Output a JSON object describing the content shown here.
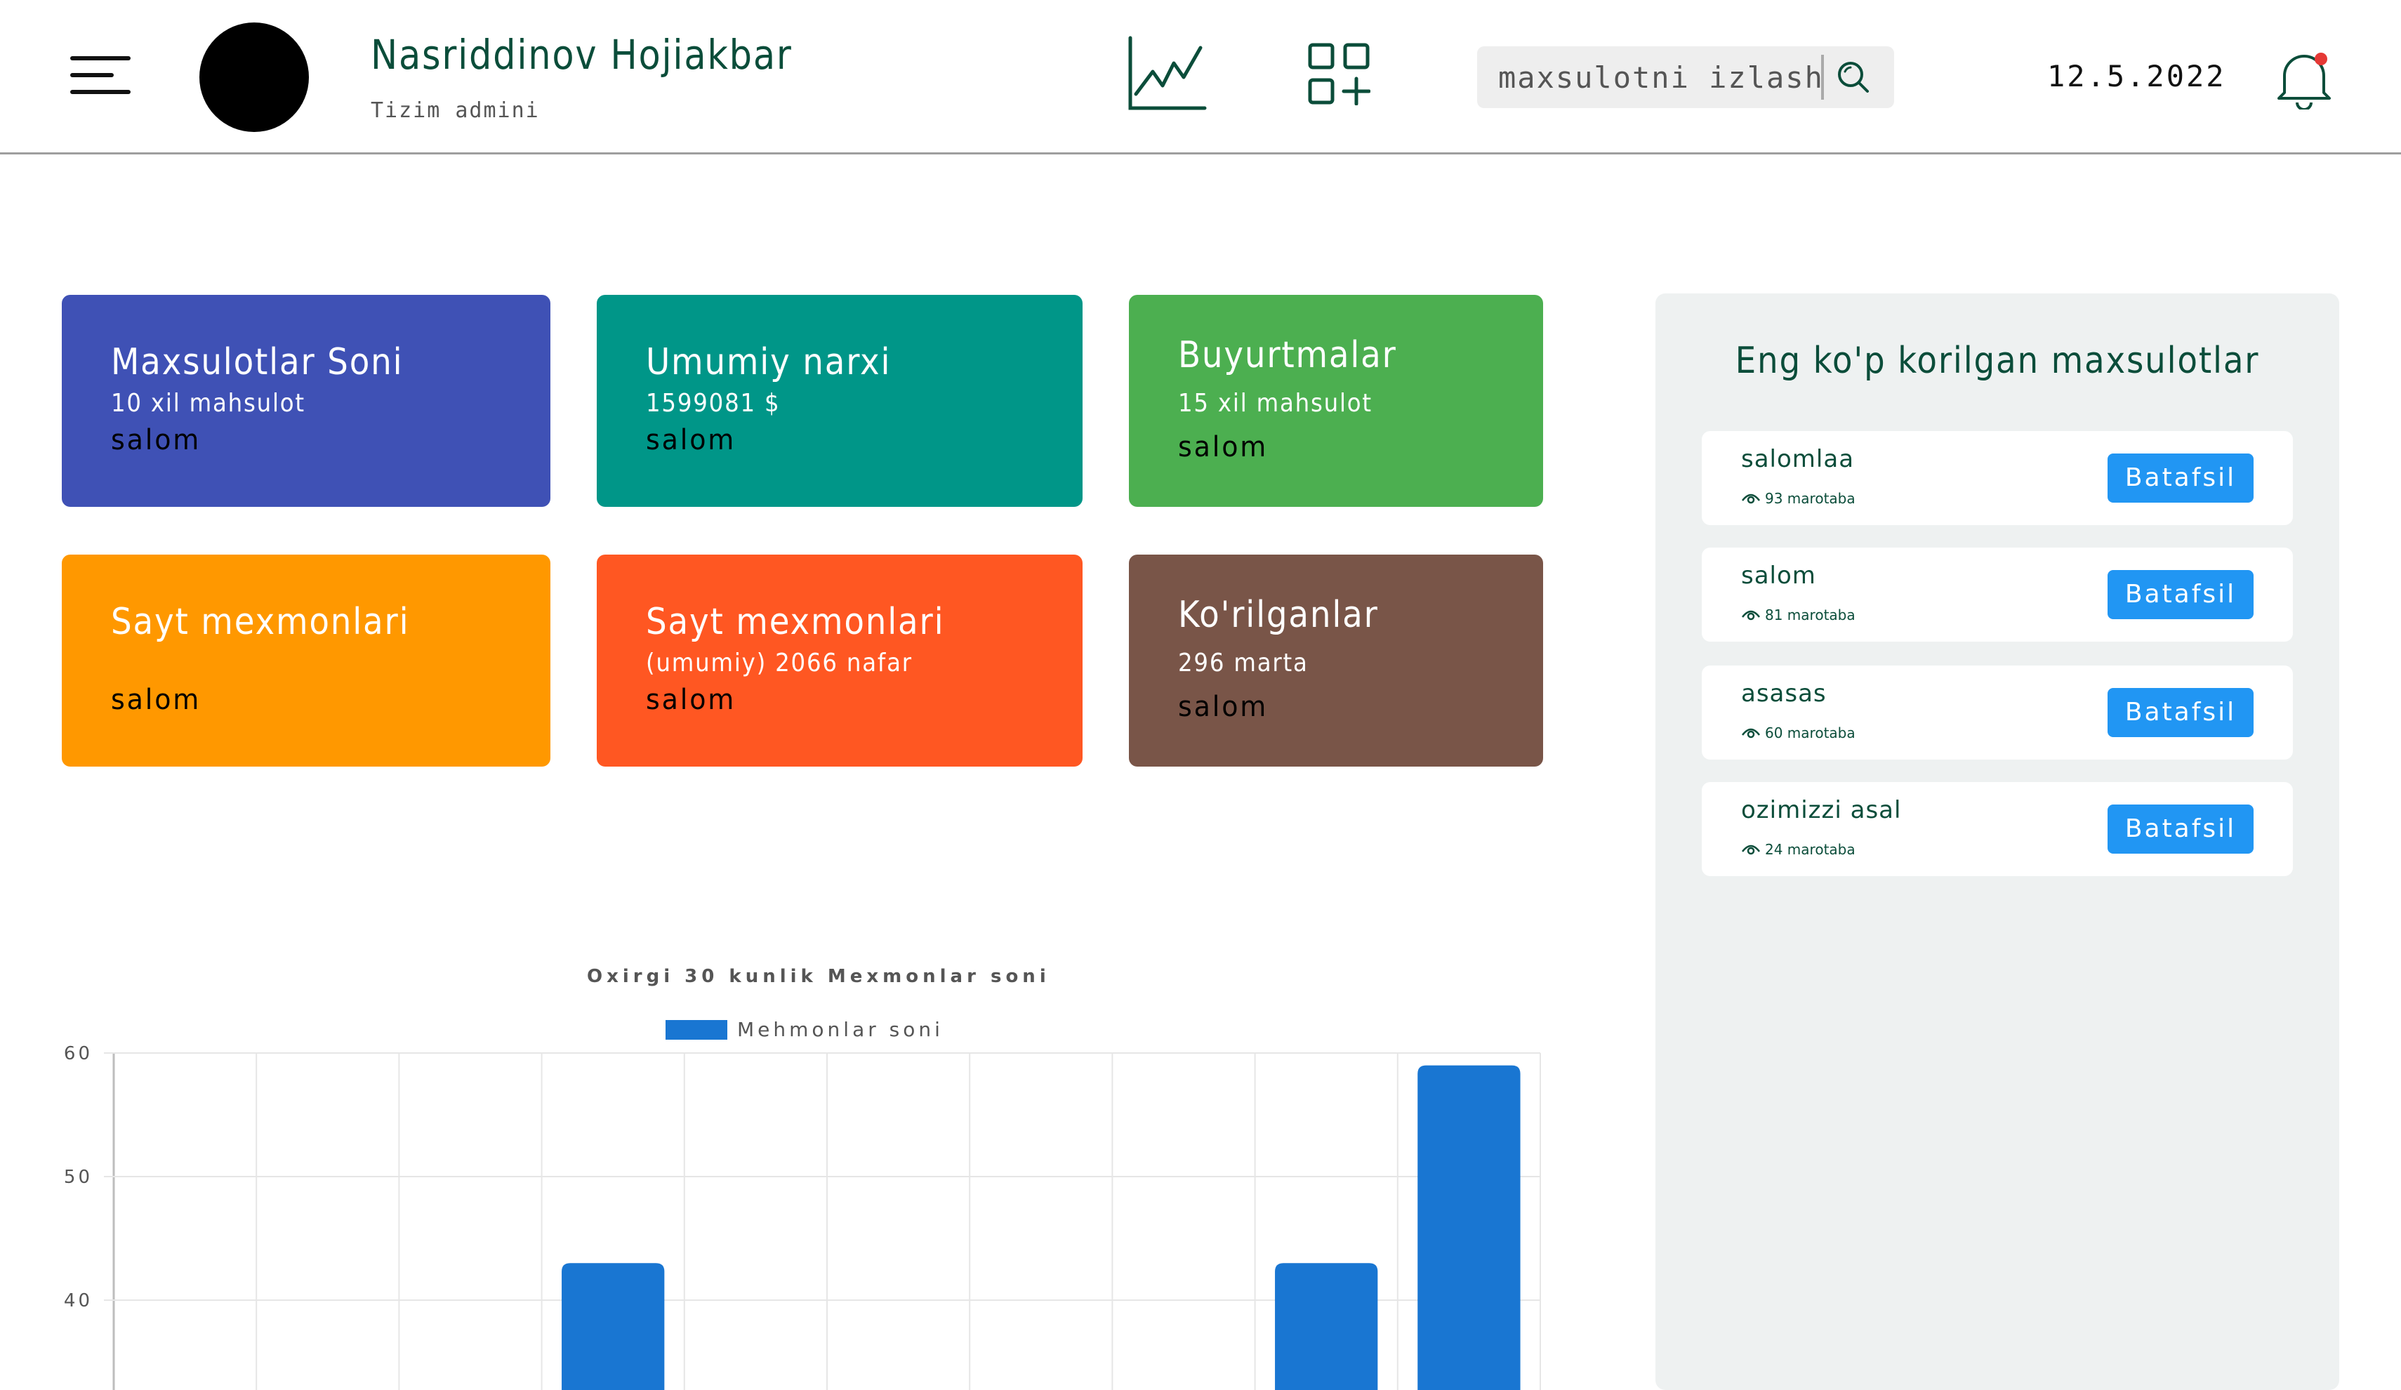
{
  "header": {
    "user_name": "Nasriddinov Hojiakbar",
    "user_role": "Tizim admini",
    "search_placeholder": "maxsulotni izlash",
    "date": "12.5.2022",
    "icons": {
      "menu": "menu-icon",
      "chart": "line-chart-icon",
      "add_category": "grid-plus-icon",
      "search": "search-icon",
      "notification": "bell-icon"
    },
    "notification_dot_color": "#e53935"
  },
  "cards": [
    {
      "title": "Maxsulotlar Soni",
      "subtitle": "10 xil mahsulot",
      "value": "salom",
      "color": "#3f51b5"
    },
    {
      "title": "Umumiy narxi",
      "subtitle": "1599081 $",
      "value": "salom",
      "color": "#009688"
    },
    {
      "title": "Buyurtmalar",
      "subtitle": "15 xil mahsulot",
      "value": "salom",
      "color": "#4caf50"
    },
    {
      "title": "Sayt mexmonlari",
      "subtitle": "",
      "value": "salom",
      "color": "#ff9800"
    },
    {
      "title": "Sayt mexmonlari",
      "subtitle": "(umumiy) 2066 nafar",
      "value": "salom",
      "color": "#ff5722"
    },
    {
      "title": "Ko'rilganlar",
      "subtitle": "296 marta",
      "value": "salom",
      "color": "#795548"
    }
  ],
  "top_products": {
    "title": "Eng ko'p korilgan maxsulotlar",
    "button_label": "Batafsil",
    "items": [
      {
        "name": "salomlaa",
        "views": "93 marotaba"
      },
      {
        "name": "salom",
        "views": "81 marotaba"
      },
      {
        "name": "asasas",
        "views": "60 marotaba"
      },
      {
        "name": "ozimizzi asal",
        "views": "24 marotaba"
      }
    ]
  },
  "chart_data": {
    "type": "bar",
    "title": "Oxirgi 30 kunlik Mexmonlar soni",
    "series": [
      {
        "name": "Mehmonlar soni",
        "values": [
          null,
          null,
          null,
          43,
          null,
          null,
          null,
          null,
          43,
          59
        ]
      }
    ],
    "categories": [
      "",
      "",
      "",
      "",
      "",
      "",
      "",
      "",
      "",
      ""
    ],
    "y_ticks": [
      60,
      50,
      40
    ],
    "ylim_visible": [
      33,
      60
    ],
    "bar_color": "#1976d2",
    "grid": true,
    "legend_position": "top"
  }
}
